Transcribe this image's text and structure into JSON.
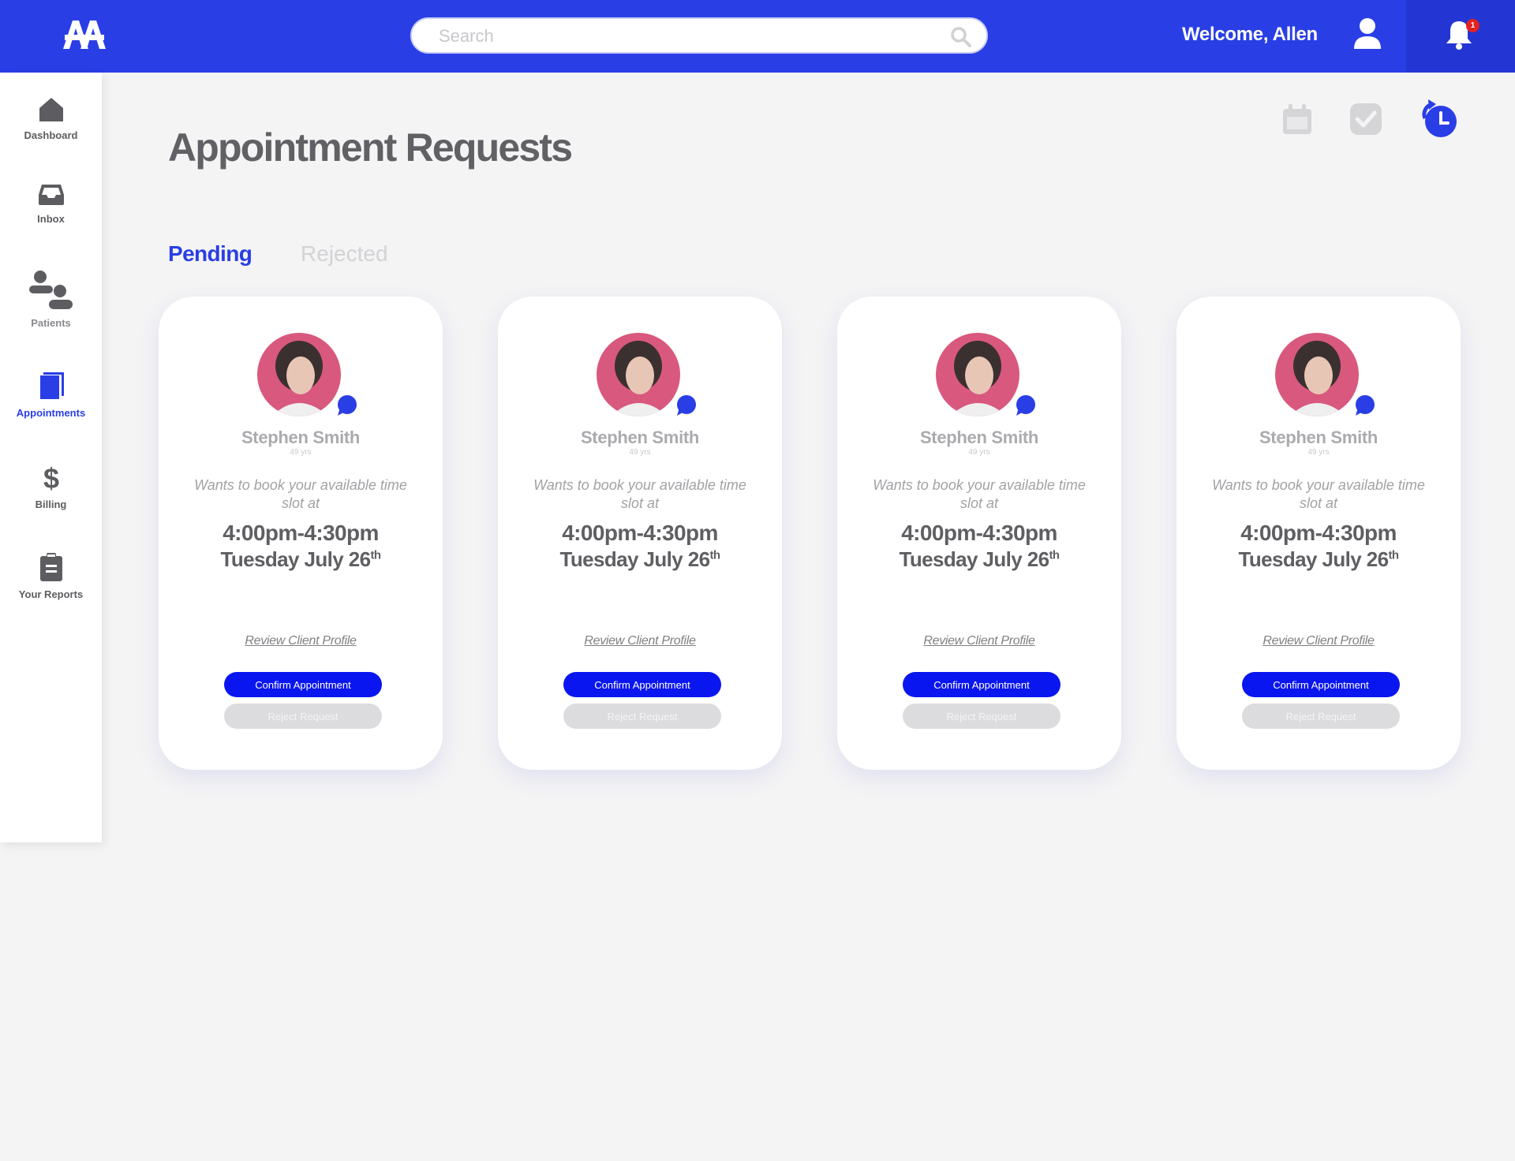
{
  "header": {
    "logo_text": "AA",
    "search_placeholder": "Search",
    "welcome": "Welcome, Allen",
    "notification_count": "1"
  },
  "sidebar": {
    "items": [
      {
        "label": "Dashboard",
        "icon": "home-icon",
        "active": false
      },
      {
        "label": "Inbox",
        "icon": "inbox-icon",
        "active": false
      },
      {
        "label": "Patients",
        "icon": "users-icon",
        "active": false
      },
      {
        "label": "Appointments",
        "icon": "book-icon",
        "active": true
      },
      {
        "label": "Billing",
        "icon": "dollar-icon",
        "active": false
      },
      {
        "label": "Your Reports",
        "icon": "clipboard-icon",
        "active": false
      }
    ]
  },
  "main": {
    "title": "Appointment Requests",
    "view_icons": [
      "calendar-icon",
      "check-icon",
      "clock-refresh-icon"
    ],
    "tabs": [
      {
        "label": "Pending",
        "active": true
      },
      {
        "label": "Rejected",
        "active": false
      }
    ],
    "cards": [
      {
        "name": "Stephen Smith",
        "age": "49 yrs",
        "request": "Wants to book your available time slot at",
        "time": "4:00pm-4:30pm",
        "date": "Tuesday July 26",
        "date_suffix": "th",
        "review": "Review Client Profile",
        "confirm": "Confirm Appointment",
        "reject": "Reject Request"
      },
      {
        "name": "Stephen Smith",
        "age": "49 yrs",
        "request": "Wants to book your available time slot at",
        "time": "4:00pm-4:30pm",
        "date": "Tuesday July 26",
        "date_suffix": "th",
        "review": "Review Client Profile",
        "confirm": "Confirm Appointment",
        "reject": "Reject Request"
      },
      {
        "name": "Stephen Smith",
        "age": "49 yrs",
        "request": "Wants to book your available time slot at",
        "time": "4:00pm-4:30pm",
        "date": "Tuesday July 26",
        "date_suffix": "th",
        "review": "Review Client Profile",
        "confirm": "Confirm Appointment",
        "reject": "Reject Request"
      },
      {
        "name": "Stephen Smith",
        "age": "49 yrs",
        "request": "Wants to book your available time slot at",
        "time": "4:00pm-4:30pm",
        "date": "Tuesday July 26",
        "date_suffix": "th",
        "review": "Review Client Profile",
        "confirm": "Confirm Appointment",
        "reject": "Reject Request"
      }
    ]
  },
  "colors": {
    "brand": "#2a3ee6",
    "confirm": "#0a16ef",
    "background": "#f4f4f5",
    "badge": "#e32121"
  }
}
